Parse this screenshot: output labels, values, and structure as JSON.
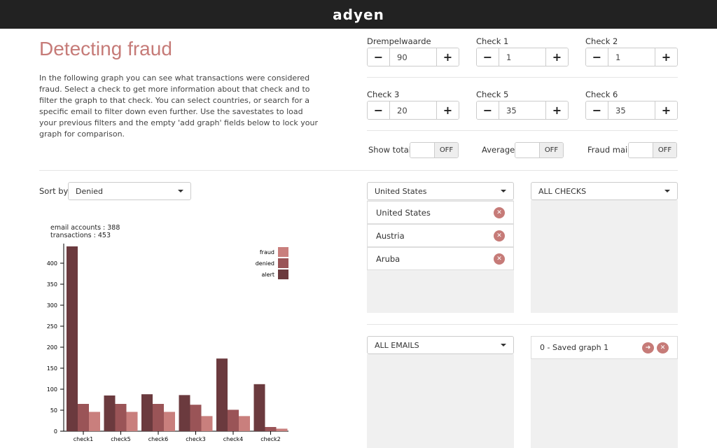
{
  "brand": "adyen",
  "page": {
    "title": "Detecting fraud",
    "intro": "In the following graph you can see what transactions were considered fraud. Select a check to get more information about that check and to filter the graph to that check. You can select countries, or search for a specific email to filter down even further. Use the savestates to load your previous filters and the empty 'add graph' fields below to lock your graph for comparison."
  },
  "fields": [
    {
      "label": "Drempelwaarde",
      "value": "90"
    },
    {
      "label": "Check 1",
      "value": "1"
    },
    {
      "label": "Check 2",
      "value": "1"
    },
    {
      "label": "Check 3",
      "value": "20"
    },
    {
      "label": "Check 5",
      "value": "35"
    },
    {
      "label": "Check 6",
      "value": "35"
    }
  ],
  "stepper": {
    "minus": "−",
    "plus": "+"
  },
  "toggles": [
    {
      "label": "Show total",
      "state": "OFF"
    },
    {
      "label": "Average",
      "state": "OFF"
    },
    {
      "label": "Fraud mail",
      "state": "OFF"
    }
  ],
  "sort": {
    "label": "Sort by",
    "value": "Denied"
  },
  "countries": {
    "selected": "United States",
    "items": [
      "United States",
      "Austria",
      "Aruba"
    ]
  },
  "checks_select": "ALL CHECKS",
  "emails_select": "ALL EMAILS",
  "saved_graph": "0 - Saved graph 1",
  "stats": {
    "email_accounts": "email accounts : 388",
    "transactions": "transactions : 453"
  },
  "chart_data": {
    "type": "bar",
    "categories": [
      "check1",
      "check5",
      "check6",
      "check3",
      "check4",
      "check2"
    ],
    "series": [
      {
        "name": "alert",
        "values": [
          440,
          85,
          88,
          86,
          173,
          112
        ]
      },
      {
        "name": "denied",
        "values": [
          65,
          65,
          65,
          63,
          51,
          10
        ]
      },
      {
        "name": "fraud",
        "values": [
          46,
          46,
          46,
          36,
          36,
          6
        ]
      }
    ],
    "legend": [
      "fraud",
      "denied",
      "alert"
    ],
    "yticks": [
      0,
      50,
      100,
      150,
      200,
      250,
      300,
      350,
      400
    ],
    "ylim": [
      0,
      440
    ],
    "colors": {
      "alert": "#6b3a3e",
      "denied": "#9a5457",
      "fraud": "#c97f7d"
    },
    "legend_position": "top-right"
  }
}
